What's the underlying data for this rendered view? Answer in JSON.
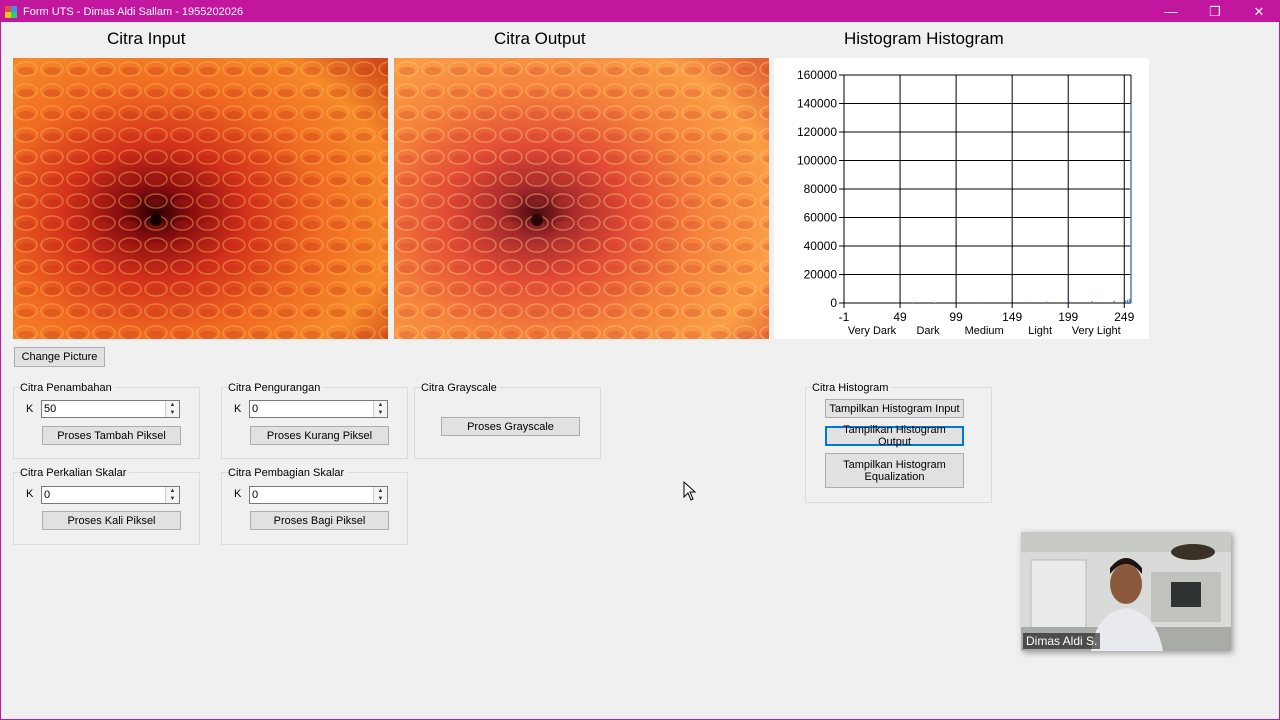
{
  "window": {
    "title": "Form UTS - Dimas Aldi Sallam - 1955202026",
    "controls": {
      "minimize": "—",
      "restore": "❐",
      "close": "✕"
    }
  },
  "headings": {
    "input": "Citra Input",
    "output": "Citra Output",
    "histogram": "Histogram Histogram"
  },
  "buttons": {
    "change_picture": "Change Picture"
  },
  "groups": {
    "penambahan": {
      "label": "Citra Penambahan",
      "k_label": "K",
      "k_value": "50",
      "button": "Proses Tambah Piksel"
    },
    "pengurangan": {
      "label": "Citra Pengurangan",
      "k_label": "K",
      "k_value": "0",
      "button": "Proses Kurang Piksel"
    },
    "grayscale": {
      "label": "Citra Grayscale",
      "button": "Proses Grayscale"
    },
    "perkalian": {
      "label": "Citra Perkalian Skalar",
      "k_label": "K",
      "k_value": "0",
      "button": "Proses Kali Piksel"
    },
    "pembagian": {
      "label": "Citra Pembagian Skalar",
      "k_label": "K",
      "k_value": "0",
      "button": "Proses Bagi Piksel"
    },
    "histogram": {
      "label": "Citra Histogram",
      "btn_input": "Tampilkan Histogram Input",
      "btn_output": "Tampilkan Histogram Output",
      "btn_equalization_line1": "Tampilkan Histogram",
      "btn_equalization_line2": "Equalization"
    }
  },
  "webcam": {
    "name": "Dimas Aldi S."
  },
  "colors": {
    "titlebar": "#c2169f",
    "series": "#4f81bd",
    "focus": "#0078d7"
  },
  "chart_data": {
    "type": "bar",
    "title": "",
    "xlabel": "",
    "ylabel": "",
    "xlim": [
      -1,
      255
    ],
    "ylim": [
      0,
      160000
    ],
    "x_ticks": [
      "-1",
      "49",
      "99",
      "149",
      "199",
      "249"
    ],
    "x_tick_values": [
      -1,
      49,
      99,
      149,
      199,
      249
    ],
    "y_ticks": [
      "0",
      "20000",
      "40000",
      "60000",
      "80000",
      "100000",
      "120000",
      "140000",
      "160000"
    ],
    "y_tick_values": [
      0,
      20000,
      40000,
      60000,
      80000,
      100000,
      120000,
      140000,
      160000
    ],
    "category_labels": [
      {
        "label": "Very Dark",
        "x": 24
      },
      {
        "label": "Dark",
        "x": 74
      },
      {
        "label": "Medium",
        "x": 124
      },
      {
        "label": "Light",
        "x": 174
      },
      {
        "label": "Very Light",
        "x": 224
      }
    ],
    "grid": true,
    "series": [
      {
        "x": [
          60,
          80,
          100,
          120,
          140,
          160,
          180,
          200,
          220,
          240,
          250,
          252,
          254,
          255
        ],
        "values": [
          300,
          400,
          500,
          600,
          700,
          800,
          900,
          1000,
          1200,
          1500,
          1800,
          2200,
          3000,
          140000
        ]
      }
    ]
  }
}
